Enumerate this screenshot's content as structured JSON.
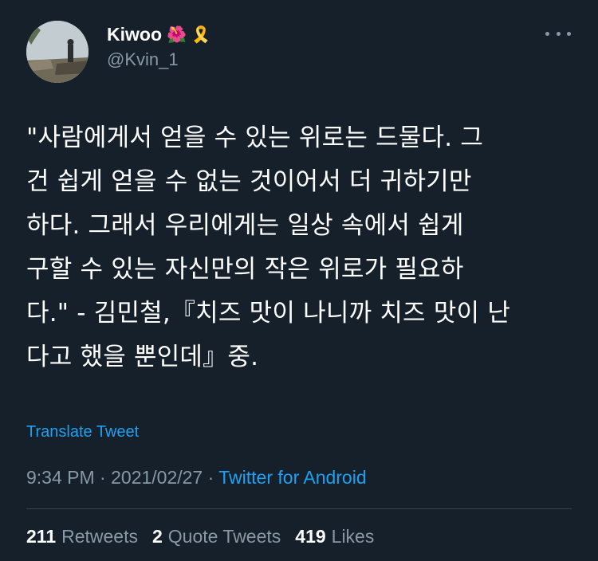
{
  "author": {
    "display_name": "Kiwoo",
    "emoji_1": "🌺",
    "emoji_2": "🎗️",
    "handle": "@Kvin_1"
  },
  "tweet": {
    "text": "\"사람에게서 얻을 수 있는 위로는 드물다. 그\n건 쉽게 얻을 수 없는 것이어서 더 귀하기만\n하다. 그래서 우리에게는 일상 속에서 쉽게\n구할 수 있는 자신만의 작은 위로가 필요하\n다.\" - 김민철,『치즈 맛이 나니까 치즈 맛이 난\n다고 했을 뿐인데』중.",
    "translate_label": "Translate Tweet"
  },
  "meta": {
    "time": "9:34 PM",
    "separator_1": " · ",
    "date": "2021/02/27",
    "separator_2": " · ",
    "source": "Twitter for Android"
  },
  "stats": {
    "retweets_count": "211",
    "retweets_label": "Retweets",
    "quotes_count": "2",
    "quotes_label": "Quote Tweets",
    "likes_count": "419",
    "likes_label": "Likes"
  },
  "colors": {
    "background": "#15202b",
    "secondary_text": "#8899a6",
    "accent": "#1da1f2",
    "divider": "#38444d"
  },
  "icons": {
    "more": "more-horizontal-icon"
  }
}
